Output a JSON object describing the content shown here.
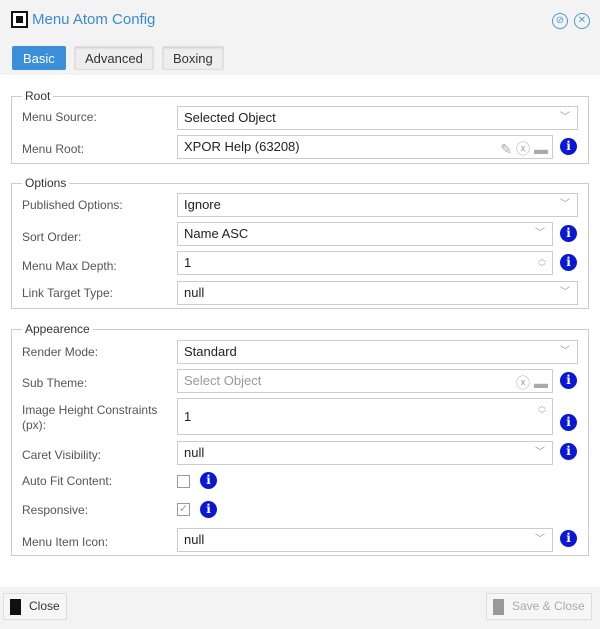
{
  "header": {
    "title": "Menu Atom Config",
    "app_icon": "atom-config-icon",
    "buttons": [
      "detach-icon",
      "close-icon"
    ]
  },
  "tabs": [
    {
      "label": "Basic",
      "active": true
    },
    {
      "label": "Advanced"
    },
    {
      "label": "Boxing"
    }
  ],
  "root": {
    "legend": "Root",
    "menu_source": {
      "label": "Menu Source:",
      "value": "Selected Object"
    },
    "menu_root": {
      "label": "Menu Root:",
      "value": "XPOR Help (63208)"
    }
  },
  "options": {
    "legend": "Options",
    "published": {
      "label": "Published Options:",
      "value": "Ignore"
    },
    "sort": {
      "label": "Sort Order:",
      "value": "Name ASC"
    },
    "depth": {
      "label": "Menu Max Depth:",
      "value": "1"
    },
    "link": {
      "label": "Link Target Type:",
      "value": "null"
    }
  },
  "appearance": {
    "legend": "Appearence",
    "render": {
      "label": "Render Mode:",
      "value": "Standard"
    },
    "subtheme": {
      "label": "Sub Theme:",
      "placeholder": "Select Object"
    },
    "imgh": {
      "label1": "Image Height Constraints",
      "label2": "(px):",
      "value": "1"
    },
    "caret": {
      "label": "Caret Visibility:",
      "value": "null"
    },
    "autofit": {
      "label": "Auto Fit Content:",
      "checked": false
    },
    "responsive": {
      "label": "Responsive:",
      "checked": true
    },
    "itemicon": {
      "label": "Menu Item Icon:",
      "value": "null"
    }
  },
  "footer": {
    "close": "Close",
    "save": "Save & Close"
  },
  "colors": {
    "accent": "#3a8fd8",
    "info": "#0a18d6"
  }
}
